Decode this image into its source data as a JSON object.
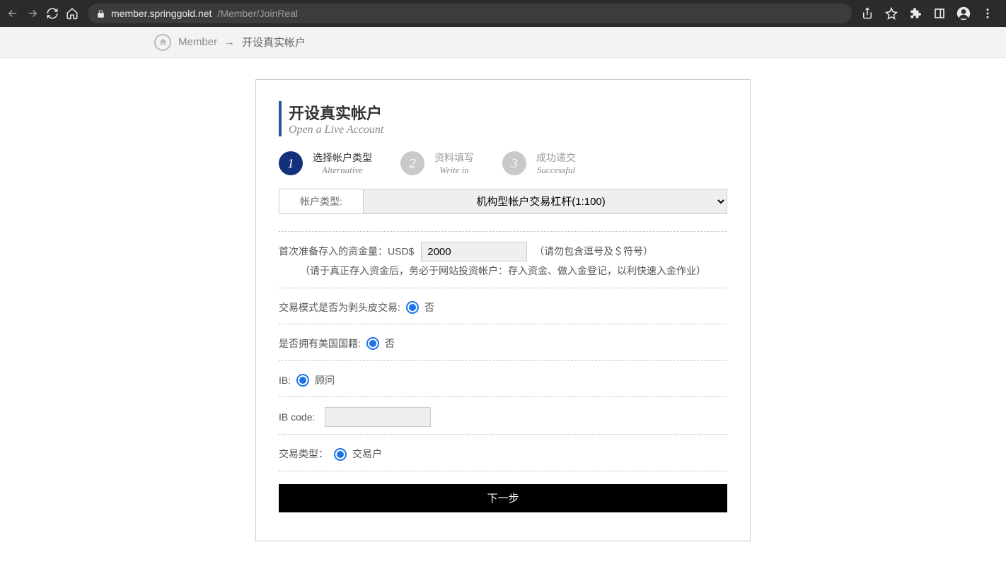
{
  "browser": {
    "url_domain": "member.springgold.net",
    "url_path": "/Member/JoinReal"
  },
  "breadcrumb": {
    "home": "Member",
    "arrow": "→",
    "current": "开设真实帐户"
  },
  "header": {
    "title": "开设真实帐户",
    "subtitle": "Open a Live Account"
  },
  "steps": [
    {
      "num": "1",
      "cn": "选择帐户类型",
      "en": "Alternative",
      "active": true
    },
    {
      "num": "2",
      "cn": "资料填写",
      "en": "Write in",
      "active": false
    },
    {
      "num": "3",
      "cn": "成功递交",
      "en": "Successful",
      "active": false
    }
  ],
  "form": {
    "acct_type_label": "帐户类型:",
    "acct_type_value": "机构型帐户交易杠杆(1:100)",
    "deposit_label": "首次准备存入的资金量：USD$",
    "deposit_value": "2000",
    "deposit_hint": "（请勿包含逗号及＄符号）",
    "deposit_note": "（请于真正存入资金后，务必于网站投资帐户：存入资金、做入金登记，以利快速入金作业）",
    "scalp_label": "交易模式是否为剥头皮交易:",
    "scalp_value": "否",
    "us_label": "是否拥有美国国籍:",
    "us_value": "否",
    "ib_label": "IB:",
    "ib_value": "顾问",
    "ibcode_label": "IB code:",
    "ibcode_value": "",
    "txtype_label": "交易类型：",
    "txtype_value": "交易户",
    "next_btn": "下一步"
  }
}
